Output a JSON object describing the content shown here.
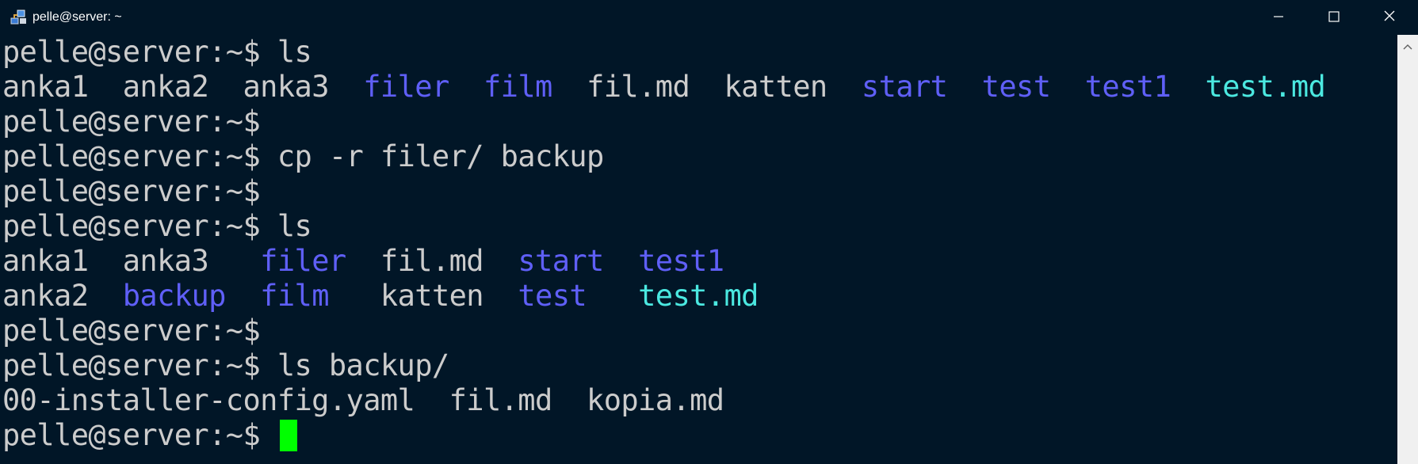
{
  "window": {
    "title": "pelle@server: ~",
    "controls": {
      "minimize_icon": "minimize-icon",
      "maximize_icon": "maximize-icon",
      "close_icon": "close-icon"
    }
  },
  "colors": {
    "background": "#011627",
    "text": "#cccccc",
    "directory": "#5f5ff7",
    "file_highlight": "#4be8e0",
    "cursor": "#00ff00"
  },
  "terminal": {
    "prompt": "pelle@server:~$",
    "lines": [
      {
        "prompt": "pelle@server:~$",
        "command": " ls"
      },
      {
        "tokens": [
          {
            "text": "anka1",
            "type": "file",
            "sep": "  "
          },
          {
            "text": "anka2",
            "type": "file",
            "sep": "  "
          },
          {
            "text": "anka3",
            "type": "file",
            "sep": "  "
          },
          {
            "text": "filer",
            "type": "dir",
            "sep": "  "
          },
          {
            "text": "film",
            "type": "dir",
            "sep": "  "
          },
          {
            "text": "fil.md",
            "type": "file",
            "sep": "  "
          },
          {
            "text": "katten",
            "type": "file",
            "sep": "  "
          },
          {
            "text": "start",
            "type": "dir",
            "sep": "  "
          },
          {
            "text": "test",
            "type": "dir",
            "sep": "  "
          },
          {
            "text": "test1",
            "type": "dir",
            "sep": "  "
          },
          {
            "text": "test.md",
            "type": "highlight",
            "sep": ""
          }
        ]
      },
      {
        "prompt": "pelle@server:~$",
        "command": ""
      },
      {
        "prompt": "pelle@server:~$",
        "command": " cp -r filer/ backup"
      },
      {
        "prompt": "pelle@server:~$",
        "command": ""
      },
      {
        "prompt": "pelle@server:~$",
        "command": " ls"
      },
      {
        "tokens": [
          {
            "text": "anka1",
            "type": "file",
            "sep": "  "
          },
          {
            "text": "anka3",
            "type": "file",
            "sep": "   "
          },
          {
            "text": "filer",
            "type": "dir",
            "sep": "  "
          },
          {
            "text": "fil.md",
            "type": "file",
            "sep": "  "
          },
          {
            "text": "start",
            "type": "dir",
            "sep": "  "
          },
          {
            "text": "test1",
            "type": "dir",
            "sep": ""
          }
        ]
      },
      {
        "tokens": [
          {
            "text": "anka2",
            "type": "file",
            "sep": "  "
          },
          {
            "text": "backup",
            "type": "dir",
            "sep": "  "
          },
          {
            "text": "film",
            "type": "dir",
            "sep": "   "
          },
          {
            "text": "katten",
            "type": "file",
            "sep": "  "
          },
          {
            "text": "test",
            "type": "dir",
            "sep": "   "
          },
          {
            "text": "test.md",
            "type": "highlight",
            "sep": ""
          }
        ]
      },
      {
        "prompt": "pelle@server:~$",
        "command": ""
      },
      {
        "prompt": "pelle@server:~$",
        "command": " ls backup/"
      },
      {
        "tokens": [
          {
            "text": "00-installer-config.yaml",
            "type": "file",
            "sep": "  "
          },
          {
            "text": "fil.md",
            "type": "file",
            "sep": "  "
          },
          {
            "text": "kopia.md",
            "type": "file",
            "sep": ""
          }
        ]
      },
      {
        "prompt": "pelle@server:~$",
        "command": " ",
        "cursor": true
      }
    ]
  }
}
